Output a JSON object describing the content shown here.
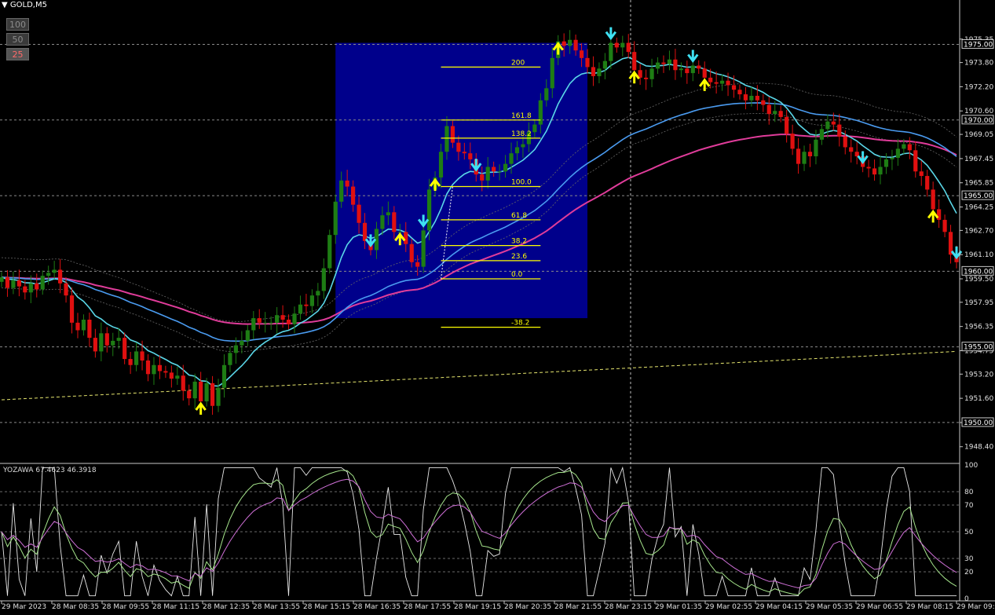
{
  "window": {
    "title": "GOLD,M5"
  },
  "zoom_buttons": [
    "100",
    "50",
    "25"
  ],
  "indicator": {
    "label": "YOZAWA 67.4623 46.3918"
  },
  "chart_data": {
    "type": "candlestick",
    "symbol": "GOLD",
    "timeframe": "M5",
    "price_axis": {
      "ylim": [
        1947.4,
        1977.0
      ],
      "ticks": [
        "1975.35",
        "1973.80",
        "1972.20",
        "1970.60",
        "1969.05",
        "1967.45",
        "1965.85",
        "1964.25",
        "1962.70",
        "1961.10",
        "1959.50",
        "1957.95",
        "1956.35",
        "1954.75",
        "1953.20",
        "1951.60",
        "1950.00",
        "1948.40"
      ],
      "tick_values": [
        1975.35,
        1973.8,
        1972.2,
        1970.6,
        1969.05,
        1967.45,
        1965.85,
        1964.25,
        1962.7,
        1961.1,
        1959.5,
        1957.95,
        1956.35,
        1954.75,
        1953.2,
        1951.6,
        1950.0,
        1948.4
      ],
      "levels": [
        "1975.00",
        "1970.00",
        "1965.00",
        "1960.00",
        "1955.00",
        "1950.00"
      ],
      "level_values": [
        1975.0,
        1970.0,
        1965.0,
        1960.0,
        1955.0,
        1950.0
      ]
    },
    "time_axis": {
      "labels": [
        "29 Mar 2023",
        "28 Mar 08:35",
        "28 Mar 09:55",
        "28 Mar 11:15",
        "28 Mar 12:35",
        "28 Mar 13:55",
        "28 Mar 15:15",
        "28 Mar 16:35",
        "28 Mar 17:55",
        "28 Mar 19:15",
        "28 Mar 20:35",
        "28 Mar 21:55",
        "28 Mar 23:15",
        "29 Mar 01:35",
        "29 Mar 02:55",
        "29 Mar 04:15",
        "29 Mar 05:35",
        "29 Mar 06:55",
        "29 Mar 08:15",
        "29 Mar 09:35"
      ]
    },
    "fibonacci": {
      "levels": [
        "200",
        "161.8",
        "138.2",
        "100.0",
        "61.8",
        "38.2",
        "23.6",
        "0.0",
        "-38.2"
      ],
      "prices": [
        1973.5,
        1970.0,
        1968.8,
        1965.6,
        1963.4,
        1961.7,
        1960.7,
        1959.5,
        1956.3
      ]
    },
    "colors": {
      "bull": "#1e7d14",
      "bear": "#e01010",
      "fast_ma": "#5ad7e8",
      "slow_ma": "#4a9bf0",
      "pink_ma": "#e03c9a",
      "fibo": "#ffff00",
      "box": "#00008b"
    },
    "series": [
      {
        "name": "close",
        "values": [
          1959.6,
          1958.9,
          1959.4,
          1959.0,
          1958.6,
          1959.2,
          1958.8,
          1959.7,
          1959.9,
          1960.1,
          1959.2,
          1958.4,
          1956.6,
          1956.1,
          1956.8,
          1955.6,
          1954.7,
          1955.9,
          1955.1,
          1955.4,
          1955.6,
          1954.2,
          1953.8,
          1954.7,
          1954.1,
          1953.2,
          1953.8,
          1953.4,
          1953.3,
          1952.9,
          1953.1,
          1952.1,
          1951.6,
          1952.7,
          1951.4,
          1952.6,
          1951.1,
          1952.3,
          1953.8,
          1954.6,
          1955.1,
          1955.4,
          1956.1,
          1956.9,
          1956.6,
          1956.6,
          1956.6,
          1957.1,
          1956.8,
          1956.5,
          1957.2,
          1957.8,
          1957.7,
          1958.4,
          1958.7,
          1960.2,
          1962.4,
          1964.6,
          1966.0,
          1965.6,
          1964.4,
          1963.2,
          1962.0,
          1961.4,
          1962.8,
          1963.7,
          1963.9,
          1962.6,
          1962.6,
          1961.8,
          1960.6,
          1960.3,
          1962.7,
          1965.4,
          1966.2,
          1967.9,
          1969.6,
          1968.5,
          1967.9,
          1967.8,
          1967.4,
          1966.4,
          1966.0,
          1966.9,
          1966.6,
          1966.6,
          1967.1,
          1967.8,
          1968.2,
          1968.4,
          1969.2,
          1969.7,
          1971.3,
          1972.1,
          1974.1,
          1975.2,
          1974.9,
          1975.3,
          1974.6,
          1974.1,
          1973.5,
          1972.9,
          1973.4,
          1973.9,
          1975.1,
          1974.8,
          1975.1,
          1974.5,
          1973.3,
          1972.8,
          1972.7,
          1973.4,
          1973.8,
          1973.7,
          1974.0,
          1973.3,
          1973.4,
          1973.1,
          1973.6,
          1973.4,
          1972.8,
          1972.5,
          1972.4,
          1972.6,
          1972.3,
          1972.0,
          1971.7,
          1971.3,
          1971.6,
          1971.3,
          1971.0,
          1970.4,
          1970.6,
          1970.2,
          1969.1,
          1968.1,
          1967.1,
          1967.9,
          1967.6,
          1968.7,
          1969.4,
          1969.9,
          1969.7,
          1968.9,
          1968.2,
          1967.9,
          1967.6,
          1966.9,
          1966.8,
          1966.4,
          1966.9,
          1967.4,
          1967.5,
          1968.1,
          1968.4,
          1968.0,
          1966.6,
          1966.3,
          1965.4,
          1964.1,
          1963.4,
          1962.6,
          1961.1,
          1960.6
        ]
      }
    ],
    "signals": [
      {
        "type": "up",
        "index": 34
      },
      {
        "type": "down",
        "index": 63
      },
      {
        "type": "up",
        "index": 68
      },
      {
        "type": "down",
        "index": 72
      },
      {
        "type": "up",
        "index": 74
      },
      {
        "type": "down",
        "index": 81
      },
      {
        "type": "up",
        "index": 95
      },
      {
        "type": "down",
        "index": 104
      },
      {
        "type": "up",
        "index": 108
      },
      {
        "type": "down",
        "index": 118
      },
      {
        "type": "up",
        "index": 120
      },
      {
        "type": "down",
        "index": 147
      },
      {
        "type": "up",
        "index": 159
      },
      {
        "type": "down",
        "index": 163
      },
      {
        "type": "up",
        "index": 170
      },
      {
        "type": "down",
        "index": 180
      }
    ],
    "oscillator": {
      "name": "YOZAWA",
      "values": [
        "67.4623",
        "46.3918"
      ],
      "ylim": [
        0,
        100
      ],
      "ticks": [
        "100",
        "80",
        "70",
        "50",
        "30",
        "20",
        "0"
      ],
      "tick_values": [
        100,
        80,
        70,
        50,
        30,
        20,
        0
      ]
    }
  }
}
